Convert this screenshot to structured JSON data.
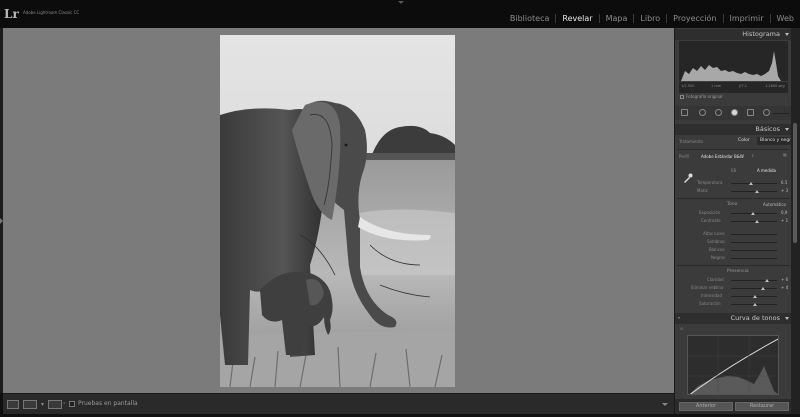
{
  "app": {
    "logo": "Lr",
    "name": "Adobe Lightroom Classic CC"
  },
  "modules": [
    "Biblioteca",
    "Revelar",
    "Mapa",
    "Libro",
    "Proyección",
    "Imprimir",
    "Web"
  ],
  "active_module": "Revelar",
  "toolbar": {
    "view_menu_chevron": "▾",
    "soft_proof_label": "Pruebas en pantalla"
  },
  "histogram": {
    "title": "Histograma",
    "readouts": [
      "1/2.500",
      "1 mm",
      "ƒ/7.1",
      "1.2800 seg"
    ],
    "original_label": "Fotografía original"
  },
  "basic": {
    "title": "Básicos",
    "treatment_label": "Tratamiento",
    "color_option": "Color",
    "bw_option": "Blanco y negr",
    "profile_label": "Perfil",
    "profile_value": "Adobe Estándar B&W",
    "wb_label": "EB",
    "wb_value": "A medida",
    "temperature_label": "Temperatura",
    "temperature_value": "6.5",
    "tint_label": "Matiz",
    "tint_value": "+ 3",
    "tone_label": "Tono",
    "auto_label": "Automático",
    "exposure_label": "Exposición",
    "exposure_value": "0,9",
    "contrast_label": "Contraste",
    "contrast_value": "+ 1",
    "highlights_label": "Altas luces",
    "shadows_label": "Sombras",
    "whites_label": "Blancos",
    "blacks_label": "Negros",
    "presence_label": "Presencia",
    "clarity_label": "Claridad",
    "clarity_value": "+ 6",
    "dehaze_label": "Eliminar neblina",
    "dehaze_value": "+ 4",
    "vibrance_label": "Intensidad",
    "saturation_label": "Saturación"
  },
  "tone_curve": {
    "title": "Curva de tonos"
  },
  "footer": {
    "previous_label": "Anterior",
    "reset_label": "Restaurar"
  },
  "colors": {
    "background_canvas": "#7b7b7b",
    "panel": "#3b3b3b",
    "topbar": "#0c0c0c",
    "active_module": "#e8e8e8"
  }
}
